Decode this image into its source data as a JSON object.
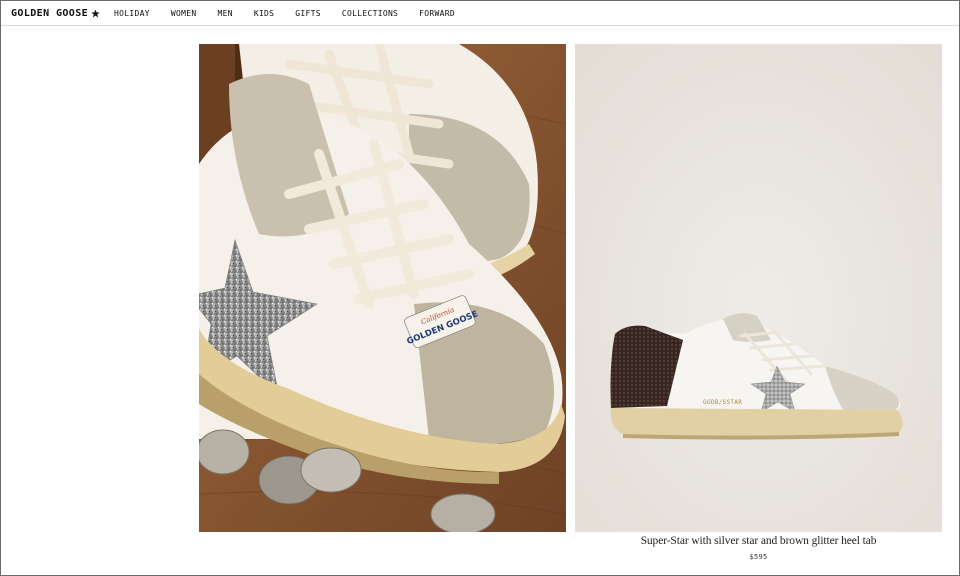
{
  "brand": {
    "name": "GOLDEN GOOSE",
    "logo_icon": "star-icon"
  },
  "nav": [
    "HOLIDAY",
    "WOMEN",
    "MEN",
    "KIDS",
    "GIFTS",
    "COLLECTIONS",
    "FORWARD"
  ],
  "tag_label": {
    "line1": "California",
    "line2": "GOLDEN GOOSE"
  },
  "product_brand_print": "GGDB/SSTAR",
  "product": {
    "title": "Super-Star with silver star and brown glitter heel tab",
    "price": "$595"
  },
  "colors": {
    "page_bg": "#ffffff",
    "wood_floor": "#8a5a36",
    "studio_bg": "#e9e5df",
    "glitter_silver": "#a9a9a9",
    "glitter_brown": "#3a2824"
  }
}
